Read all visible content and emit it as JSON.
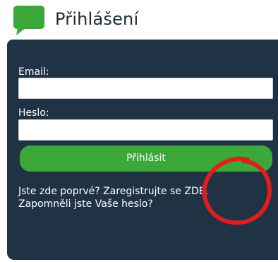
{
  "header": {
    "title": "Přihlášení",
    "brand_color": "#3da83a"
  },
  "form": {
    "email_label": "Email:",
    "email_value": "",
    "password_label": "Heslo:",
    "password_value": "",
    "submit_label": "Přihlásit"
  },
  "links": {
    "first_visit_text": "Jste zde poprvé? Zaregistrujte se ",
    "register_link": "ZDE.",
    "forgot_password": "Zapomněli jste Vaše heslo?"
  },
  "colors": {
    "panel": "#1f3344",
    "button": "#3da83a",
    "annotation": "#e21d1d"
  }
}
